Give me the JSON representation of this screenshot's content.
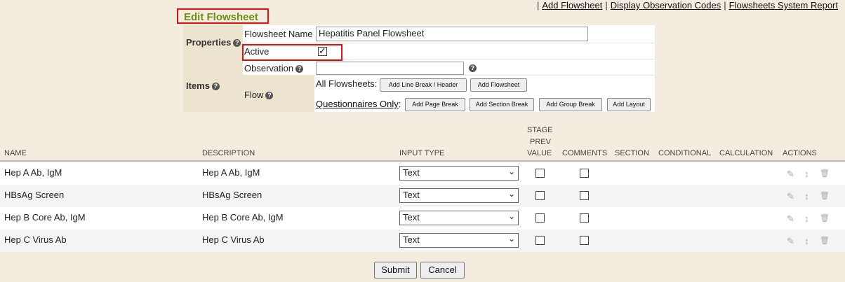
{
  "toplinks": {
    "add_flowsheet": "Add Flowsheet",
    "display_codes": "Display Observation Codes",
    "system_report": "Flowsheets System Report"
  },
  "page_title": "Edit Flowsheet",
  "properties": {
    "section_label": "Properties",
    "name_label": "Flowsheet Name",
    "name_value": "Hepatitis Panel Flowsheet",
    "active_label": "Active",
    "active_checked": true
  },
  "items": {
    "section_label": "Items",
    "observation_label": "Observation",
    "observation_value": "",
    "flow_label": "Flow",
    "all_flowsheets_label": "All Flowsheets:",
    "add_line_break": "Add Line Break / Header",
    "add_flowsheet": "Add Flowsheet",
    "questionnaires_label": "Questionnaires Only",
    "questionnaires_colon": ":",
    "add_page_break": "Add Page Break",
    "add_section_break": "Add Section Break",
    "add_group_break": "Add Group Break",
    "add_layout": "Add Layout"
  },
  "grid": {
    "headers": {
      "name": "NAME",
      "description": "DESCRIPTION",
      "input_type": "INPUT TYPE",
      "stage1": "STAGE",
      "stage2": "PREV",
      "stage3": "VALUE",
      "comments": "COMMENTS",
      "section": "SECTION",
      "conditional": "CONDITIONAL",
      "calculation": "CALCULATION",
      "actions": "ACTIONS"
    },
    "rows": [
      {
        "name": "Hep A Ab, IgM",
        "description": "Hep A Ab, IgM",
        "input_type": "Text"
      },
      {
        "name": "HBsAg Screen",
        "description": "HBsAg Screen",
        "input_type": "Text"
      },
      {
        "name": "Hep B Core Ab, IgM",
        "description": "Hep B Core Ab, IgM",
        "input_type": "Text"
      },
      {
        "name": "Hep C Virus Ab",
        "description": "Hep C Virus Ab",
        "input_type": "Text"
      }
    ]
  },
  "buttons": {
    "submit": "Submit",
    "cancel": "Cancel"
  },
  "icons": {
    "help": "?",
    "edit": "✎",
    "move": "↕",
    "delete": "🗑",
    "chevron": "⌄"
  },
  "colors": {
    "background": "#f3ecdf",
    "title": "#6b8f17",
    "highlight": "#dd1111"
  }
}
